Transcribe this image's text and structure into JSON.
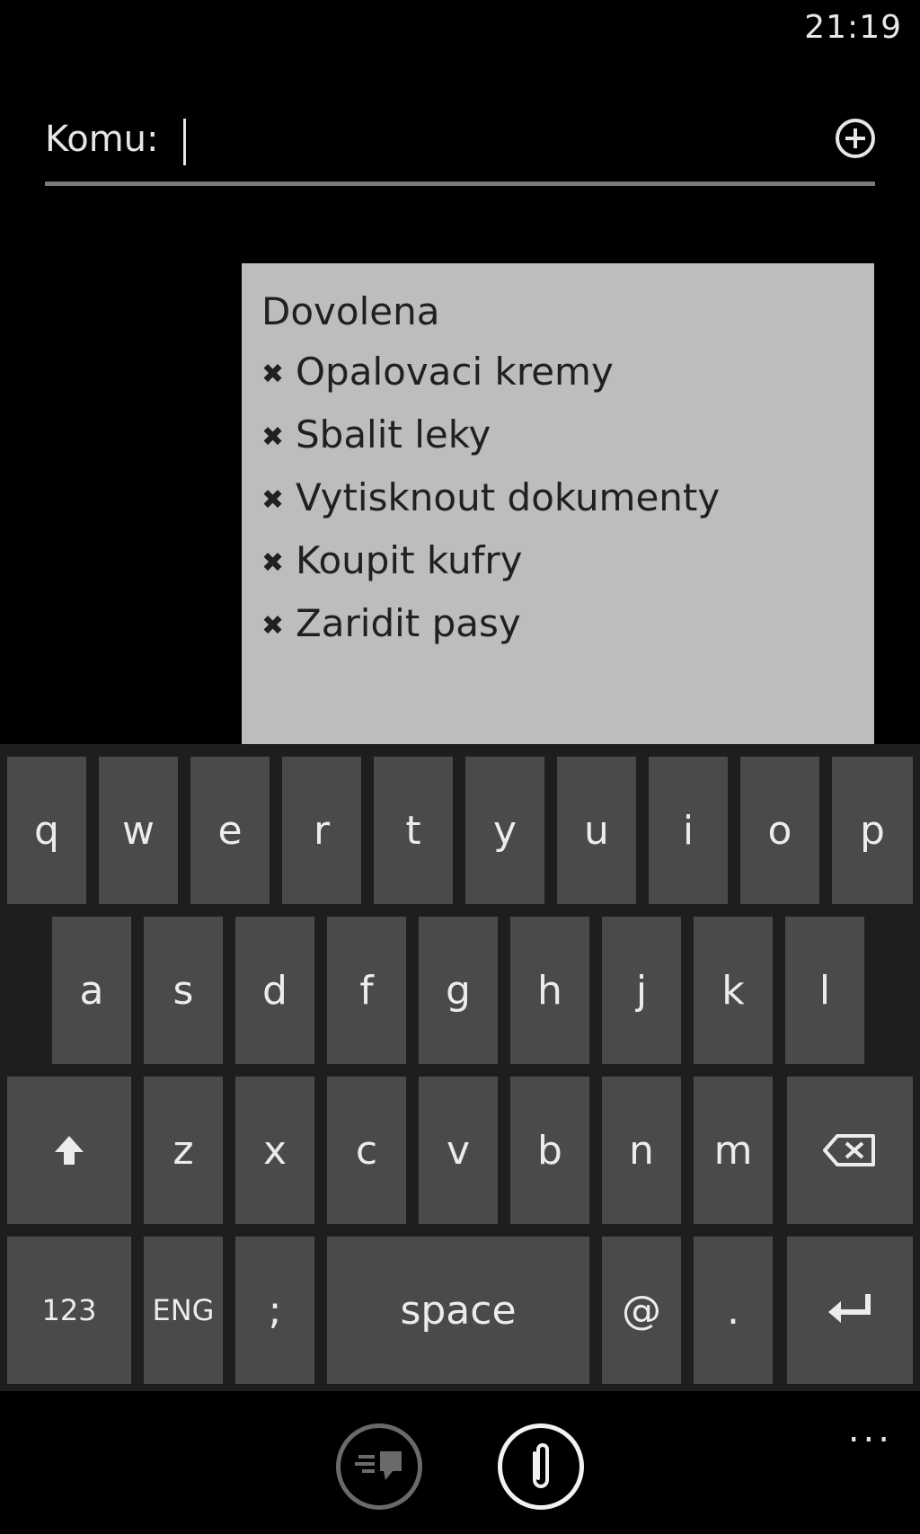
{
  "status_bar": {
    "time": "21:19"
  },
  "compose": {
    "to_label": "Komu:",
    "to_value": ""
  },
  "message": {
    "title": "Dovolena",
    "bullet_icon": "x-mark-icon",
    "items": [
      "Opalovaci kremy",
      "Sbalit leky",
      "Vytisknout dokumenty",
      "Koupit kufry",
      "Zaridit pasy"
    ]
  },
  "keyboard": {
    "row1": [
      "q",
      "w",
      "e",
      "r",
      "t",
      "y",
      "u",
      "i",
      "o",
      "p"
    ],
    "row2": [
      "a",
      "s",
      "d",
      "f",
      "g",
      "h",
      "j",
      "k",
      "l"
    ],
    "row3": [
      "z",
      "x",
      "c",
      "v",
      "b",
      "n",
      "m"
    ],
    "row4": {
      "numbers": "123",
      "language": "ENG",
      "semicolon": ";",
      "space": "space",
      "at": "@",
      "period": "."
    }
  },
  "app_bar": {
    "more": "..."
  }
}
